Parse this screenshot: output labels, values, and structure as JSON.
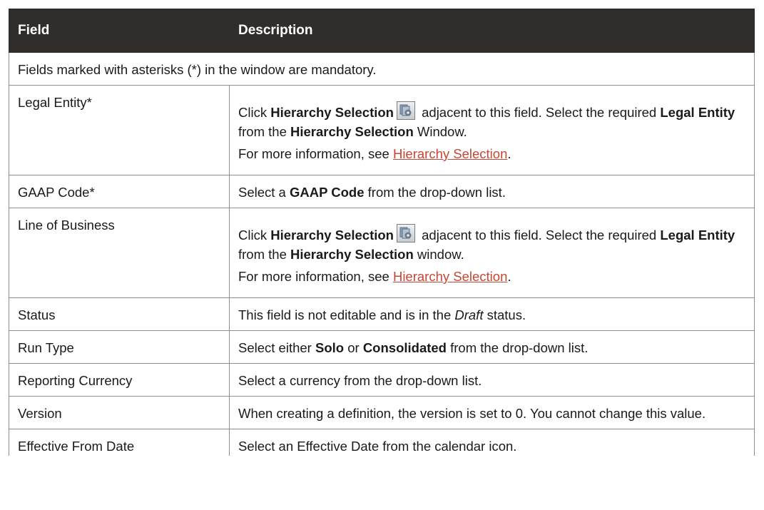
{
  "table": {
    "headers": {
      "field": "Field",
      "description": "Description"
    },
    "note": "Fields marked with asterisks (*) in the window are mandatory.",
    "rows": {
      "legal_entity": {
        "field": "Legal Entity*",
        "line1_a": "Click ",
        "line1_bold": "Hierarchy Selection",
        "line1_b": " adjacent to this field. Select the required ",
        "line1_bold2": "Legal Entity",
        "line1_c": " from the ",
        "line1_bold3": "Hierarchy Selection",
        "line1_d": " Window.",
        "more_prefix": "For more information, see ",
        "more_link": "Hierarchy Selection",
        "more_suffix": "."
      },
      "gaap_code": {
        "field": "GAAP Code*",
        "a": "Select a ",
        "bold": "GAAP Code",
        "b": " from the drop-down list."
      },
      "line_of_business": {
        "field": "Line of Business",
        "line1_a": "Click ",
        "line1_bold": "Hierarchy Selection",
        "line1_b": " adjacent to this field. Select the required ",
        "line1_bold2": "Legal Entity",
        "line1_c": " from the ",
        "line1_bold3": "Hierarchy Selection",
        "line1_d": " window.",
        "more_prefix": "For more information, see ",
        "more_link": "Hierarchy Selection",
        "more_suffix": "."
      },
      "status": {
        "field": "Status",
        "a": "This field is not editable and is in the ",
        "italic": "Draft",
        "b": " status."
      },
      "run_type": {
        "field": "Run Type",
        "a": "Select either ",
        "bold1": "Solo",
        "b": " or ",
        "bold2": "Consolidated",
        "c": " from the drop-down list."
      },
      "reporting_currency": {
        "field": "Reporting Currency",
        "desc": "Select a currency from the drop-down list."
      },
      "version": {
        "field": "Version",
        "desc": "When creating a definition, the version is set to 0. You cannot change this value."
      },
      "effective_from_date": {
        "field": "Effective From Date",
        "desc": "Select an Effective Date from the calendar icon."
      }
    }
  },
  "icons": {
    "hierarchy_selection": "hierarchy-selection-icon"
  },
  "colors": {
    "header_bg": "#312d2a",
    "link": "#c74634",
    "border": "#8e8e8e"
  }
}
